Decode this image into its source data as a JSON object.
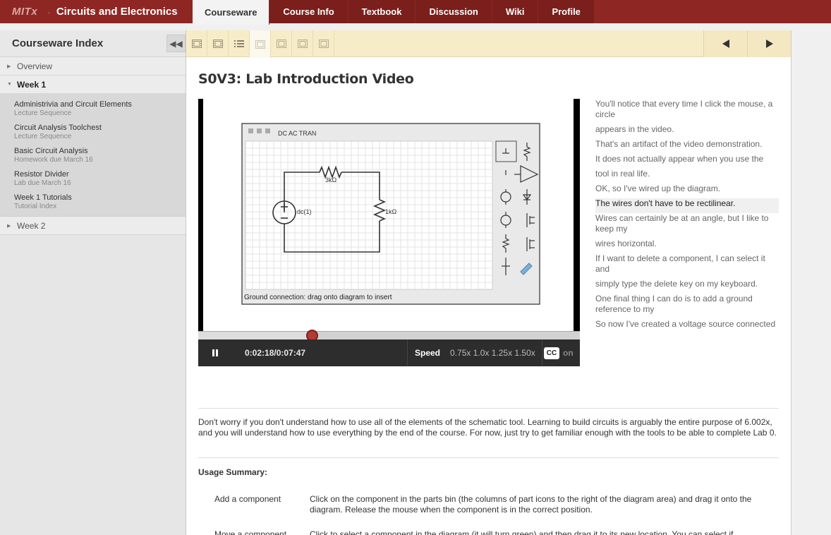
{
  "header": {
    "logo": "MITx",
    "course_title": "Circuits and Electronics",
    "tabs": [
      {
        "label": "Courseware",
        "active": true
      },
      {
        "label": "Course Info"
      },
      {
        "label": "Textbook"
      },
      {
        "label": "Discussion"
      },
      {
        "label": "Wiki"
      },
      {
        "label": "Profile"
      }
    ]
  },
  "sidebar": {
    "title": "Courseware Index",
    "chapters": [
      {
        "label": "Overview"
      },
      {
        "label": "Week 1",
        "sections": [
          {
            "name": "Administrivia and Circuit Elements",
            "sub": "Lecture Sequence"
          },
          {
            "name": "Circuit Analysis Toolchest",
            "sub": "Lecture Sequence"
          },
          {
            "name": "Basic Circuit Analysis",
            "sub": "Homework due March 16"
          },
          {
            "name": "Resistor Divider",
            "sub": "Lab due March 16"
          },
          {
            "name": "Week 1 Tutorials",
            "sub": "Tutorial Index"
          }
        ]
      },
      {
        "label": "Week 2"
      }
    ]
  },
  "sequence": {
    "items": [
      "video-icon",
      "video-icon",
      "list-icon",
      "video-icon",
      "video-icon",
      "video-icon",
      "video-icon"
    ],
    "active_index": 3
  },
  "video": {
    "title": "S0V3: Lab Introduction Video",
    "progress": 0.297,
    "time": "0:02:18/0:07:47",
    "speed_label": "Speed",
    "speed_options": "0.75x 1.0x 1.25x 1.50x",
    "cc_label": "CC",
    "cc_state": "on",
    "frame": {
      "toolbar_label": "DC AC TRAN",
      "r1": "3kΩ",
      "r2": "1kΩ",
      "source": "dc(1)",
      "status": "Ground connection: drag onto diagram to insert"
    }
  },
  "transcript": [
    "You'll notice that every time I click the mouse, a circle",
    "appears in the video.",
    "That's an artifact of the video demonstration.",
    "It does not actually appear when you use the",
    "tool in real life.",
    "OK, so I've wired up the diagram.",
    "The wires don't have to be rectilinear.",
    "Wires can certainly be at an angle, but I like to keep my",
    "wires horizontal.",
    "If I want to delete a component, I can select it and",
    "simply type the delete key on my keyboard.",
    "One final thing I can do is to add a ground reference to my",
    "So now I've created a voltage source connected"
  ],
  "transcript_current": 6,
  "body": {
    "paragraph": "Don't worry if you don't understand how to use all of the elements of the schematic tool. Learning to build circuits is arguably the entire purpose of 6.002x, and you will understand how to use everything by the end of the course. For now, just try to get familiar enough with the tools to be able to complete Lab 0.",
    "usage_title": "Usage Summary:",
    "usage": [
      {
        "k": "Add a component",
        "v": "Click on the component in the parts bin (the columns of part icons to the right of the diagram area) and drag it onto the diagram. Release the mouse when the component is in the correct position."
      },
      {
        "k": "Move a component",
        "v": "Click to select a component in the diagram (it will turn green) and then drag it to its new location. You can select if"
      }
    ]
  }
}
